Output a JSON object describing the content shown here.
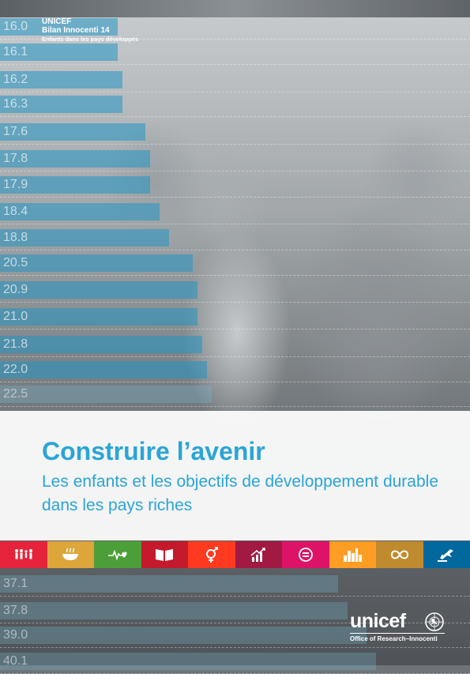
{
  "header": {
    "org": "UNICEF",
    "series": "Bilan Innocenti 14",
    "subtitle": "Enfants dans les pays développés"
  },
  "bars": [
    {
      "label": "16.0",
      "fill": 0.25,
      "dim": false
    },
    {
      "label": "16.1",
      "fill": 0.25,
      "dim": false
    },
    {
      "label": "16.2",
      "fill": 0.26,
      "dim": false
    },
    {
      "label": "16.3",
      "fill": 0.26,
      "dim": false
    },
    {
      "label": "17.6",
      "fill": 0.31,
      "dim": false
    },
    {
      "label": "17.8",
      "fill": 0.32,
      "dim": false
    },
    {
      "label": "17.9",
      "fill": 0.32,
      "dim": false
    },
    {
      "label": "18.4",
      "fill": 0.34,
      "dim": false
    },
    {
      "label": "18.8",
      "fill": 0.36,
      "dim": false
    },
    {
      "label": "20.5",
      "fill": 0.41,
      "dim": false
    },
    {
      "label": "20.9",
      "fill": 0.42,
      "dim": false
    },
    {
      "label": "21.0",
      "fill": 0.42,
      "dim": false
    },
    {
      "label": "21.8",
      "fill": 0.43,
      "dim": false
    },
    {
      "label": "22.0",
      "fill": 0.44,
      "dim": false
    },
    {
      "label": "22.5",
      "fill": 0.45,
      "dim": true
    },
    {
      "label": "37.1",
      "fill": 0.72,
      "dim": true
    },
    {
      "label": "37.8",
      "fill": 0.74,
      "dim": true
    },
    {
      "label": "39.0",
      "fill": 0.78,
      "dim": true
    },
    {
      "label": "40.1",
      "fill": 0.8,
      "dim": true
    }
  ],
  "title": "Construire l’avenir",
  "subtitle": "Les enfants et les objectifs de développement durable dans les pays riches",
  "sdg_icons": [
    {
      "name": "no-poverty-icon",
      "color": "#e5243b"
    },
    {
      "name": "zero-hunger-icon",
      "color": "#dda63a"
    },
    {
      "name": "good-health-icon",
      "color": "#4c9f38"
    },
    {
      "name": "quality-education-icon",
      "color": "#c5192d"
    },
    {
      "name": "gender-equality-icon",
      "color": "#ff3a21"
    },
    {
      "name": "decent-work-icon",
      "color": "#a21942"
    },
    {
      "name": "reduced-inequalities-icon",
      "color": "#dd1367"
    },
    {
      "name": "sustainable-cities-icon",
      "color": "#fd9d24"
    },
    {
      "name": "responsible-consumption-icon",
      "color": "#bf8b2e"
    },
    {
      "name": "peace-justice-icon",
      "color": "#00689d"
    }
  ],
  "logo": {
    "wordmark": "unicef",
    "tagline": "Office of Research–Innocenti"
  }
}
